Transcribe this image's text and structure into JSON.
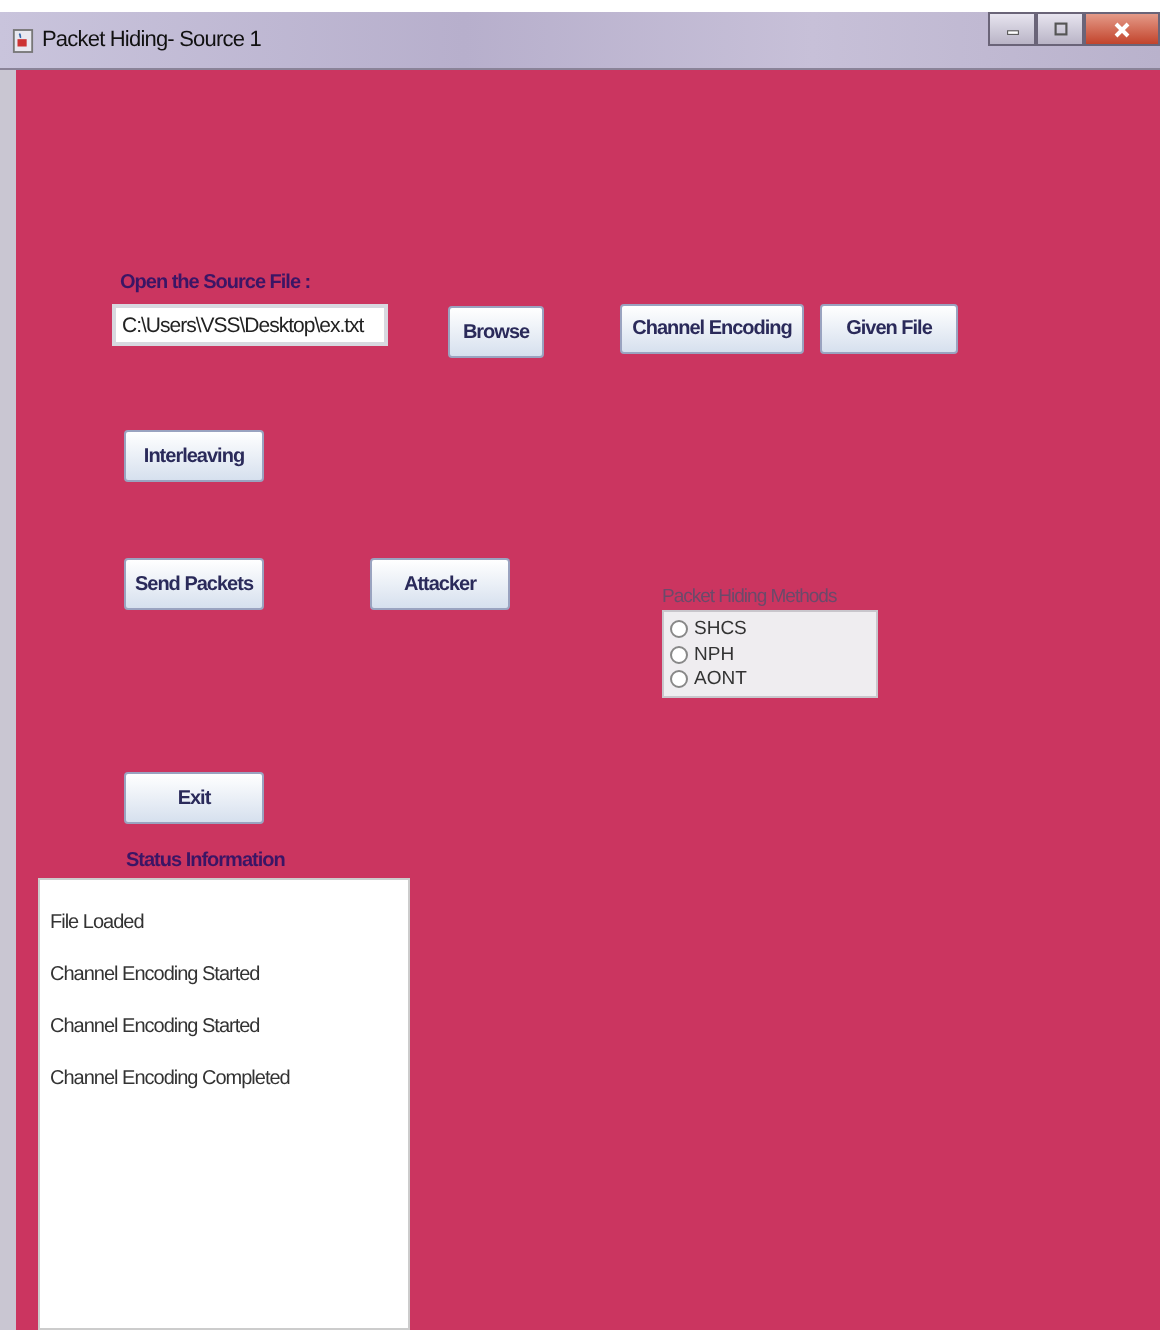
{
  "window": {
    "title": "Packet Hiding- Source 1"
  },
  "source": {
    "label": "Open the Source File :",
    "value": "C:\\Users\\VSS\\Desktop\\ex.txt"
  },
  "buttons": {
    "browse": "Browse",
    "channel_encoding": "Channel Encoding",
    "given_file": "Given File",
    "interleaving": "Interleaving",
    "send_packets": "Send Packets",
    "attacker": "Attacker",
    "exit": "Exit"
  },
  "methods": {
    "title": "Packet Hiding Methods",
    "options": [
      {
        "label": "SHCS",
        "selected": false
      },
      {
        "label": "NPH",
        "selected": false
      },
      {
        "label": "AONT",
        "selected": false
      }
    ]
  },
  "status": {
    "title": "Status Information",
    "lines": [
      "File Loaded",
      "Channel Encoding Started",
      "Channel Encoding Started",
      "Channel Encoding Completed"
    ]
  }
}
